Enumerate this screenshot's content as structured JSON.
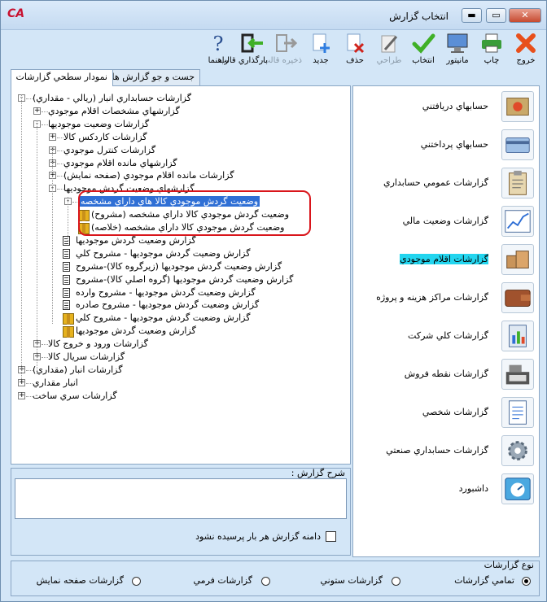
{
  "window": {
    "title": "انتخاب گزارش",
    "app_logo_text": "CA",
    "controls": {
      "minimize": "▬",
      "maximize": "▭",
      "close": "✕"
    }
  },
  "toolbar": [
    {
      "label": "خروج",
      "icon": "exit-x-icon",
      "enabled": true
    },
    {
      "label": "چاپ",
      "icon": "printer-icon",
      "enabled": true
    },
    {
      "label": "مانیتور",
      "icon": "monitor-icon",
      "enabled": true
    },
    {
      "label": "انتخاب",
      "icon": "checkmark-icon",
      "enabled": true
    },
    {
      "label": "طراحي",
      "icon": "pencil-design-icon",
      "enabled": false
    },
    {
      "label": "حذف",
      "icon": "delete-doc-icon",
      "enabled": true
    },
    {
      "label": "جديد",
      "icon": "new-doc-icon",
      "enabled": true
    },
    {
      "label": "ذخيره قالب",
      "icon": "save-template-icon",
      "enabled": false
    },
    {
      "label": "بارگذاري قالب",
      "icon": "load-template-icon",
      "enabled": true
    },
    {
      "label": "راهنما",
      "icon": "help-icon",
      "enabled": true
    }
  ],
  "tabs": [
    {
      "label": "نمودار سطحي گزارشات",
      "active": true
    },
    {
      "label": "جست و جو گزارش ها",
      "active": false
    }
  ],
  "tree": [
    {
      "text": "گزارشات حسابداري انبار (ريالي - مقداري)",
      "expander": "-",
      "icon": "none"
    },
    {
      "text": "گزارشهاي مشخصات اقلام موجودي",
      "expander": "+",
      "icon": "none"
    },
    {
      "text": "گزارشات وضعيت موجوديها",
      "expander": "-",
      "icon": "none"
    },
    {
      "text": "گزارشات كاردكس كالا",
      "expander": "+",
      "icon": "none"
    },
    {
      "text": "گزارشات كنترل موجودي",
      "expander": "+",
      "icon": "none"
    },
    {
      "text": "گزارشهاي مانده اقلام موجودي",
      "expander": "+",
      "icon": "none"
    },
    {
      "text": "گزارشات مانده اقلام موجودي (صفحه نمايش)",
      "expander": "+",
      "icon": "none"
    },
    {
      "text": "گزارشهاي وضعيت گردش موجوديها",
      "expander": "-",
      "icon": "none"
    },
    {
      "text": "وضعيت گردش موجودي كالا هاي داراي مشخصه",
      "expander": "-",
      "icon": "none",
      "selected": true
    },
    {
      "text": "وضعيت گردش موجودي كالا داراي مشخصه (مشروح)",
      "expander": "",
      "icon": "box"
    },
    {
      "text": "وضعيت گردش موجودي كالا داراي مشخصه (خلاصه)",
      "expander": "",
      "icon": "box"
    },
    {
      "text": "گزارش وضعيت گردش موجوديها",
      "expander": "",
      "icon": "doc"
    },
    {
      "text": "گزارش وضعيت گردش موجوديها - مشروح كلي",
      "expander": "",
      "icon": "doc"
    },
    {
      "text": "گزارش وضعيت گردش موجوديها (زيرگروه كالا)-مشروح",
      "expander": "",
      "icon": "doc"
    },
    {
      "text": "گزارش وضعيت گردش موجوديها (گروه اصلي كالا)-مشروح",
      "expander": "",
      "icon": "doc"
    },
    {
      "text": "گزارش وضعيت گردش موجوديها - مشروح وارده",
      "expander": "",
      "icon": "doc"
    },
    {
      "text": "گزارش وضعيت گردش موجوديها - مشروح صادره",
      "expander": "",
      "icon": "doc"
    },
    {
      "text": "گزارش وضعيت گردش موجوديها - مشروح كلي",
      "expander": "",
      "icon": "box"
    },
    {
      "text": "گزارش وضعيت گردش موجوديها",
      "expander": "",
      "icon": "box"
    },
    {
      "text": "گزارشات ورود و خروج كالا",
      "expander": "+",
      "icon": "none"
    },
    {
      "text": "گزارشات سريال كالا",
      "expander": "+",
      "icon": "none"
    },
    {
      "text": "گزارشات انبار (مقداري)",
      "expander": "+",
      "icon": "none"
    },
    {
      "text": "انبار مقداري",
      "expander": "+",
      "icon": "none"
    },
    {
      "text": "گزارشات سري ساخت",
      "expander": "+",
      "icon": "none"
    }
  ],
  "description": {
    "label": "شرح گزارش :",
    "value": "",
    "persist_label": "دامنه گزارش هر بار پرسيده نشود",
    "persist_checked": false
  },
  "categories": [
    {
      "label": "حسابهاي دريافتني",
      "icon": "receivables-icon",
      "highlighted": false
    },
    {
      "label": "حسابهاي پرداختني",
      "icon": "payables-card-icon",
      "highlighted": false
    },
    {
      "label": "گزارشات عمومي حسابداري",
      "icon": "clipboard-icon",
      "highlighted": false
    },
    {
      "label": "گزارشات وضعيت مالي",
      "icon": "line-chart-icon",
      "highlighted": false
    },
    {
      "label": "گزارشات اقلام موجودي",
      "icon": "boxes-icon",
      "highlighted": true
    },
    {
      "label": "گزارشات مراكز هزينه و پروژه",
      "icon": "wallet-icon",
      "highlighted": false
    },
    {
      "label": "گزارشات كلي شركت",
      "icon": "company-report-icon",
      "highlighted": false
    },
    {
      "label": "گزارشات نقطه فروش",
      "icon": "cash-register-icon",
      "highlighted": false
    },
    {
      "label": "گزارشات شخصي",
      "icon": "personal-doc-icon",
      "highlighted": false
    },
    {
      "label": "گزارشات حسابداري صنعتي",
      "icon": "gear-icon",
      "highlighted": false
    },
    {
      "label": "داشبورد",
      "icon": "dashboard-icon",
      "highlighted": false
    }
  ],
  "report_type": {
    "label": "نوع گزارشات",
    "options": [
      {
        "label": "تمامي گزارشات",
        "selected": true
      },
      {
        "label": "گزارشات ستوني",
        "selected": false
      },
      {
        "label": "گزارشات فرمي",
        "selected": false
      },
      {
        "label": "گزارشات صفحه نمايش",
        "selected": false
      }
    ]
  },
  "colors": {
    "selection": "#2f6fd5",
    "highlight": "#23d5ef",
    "annotation_ring": "#d9151b",
    "window_bg": "#d3e6f7"
  }
}
